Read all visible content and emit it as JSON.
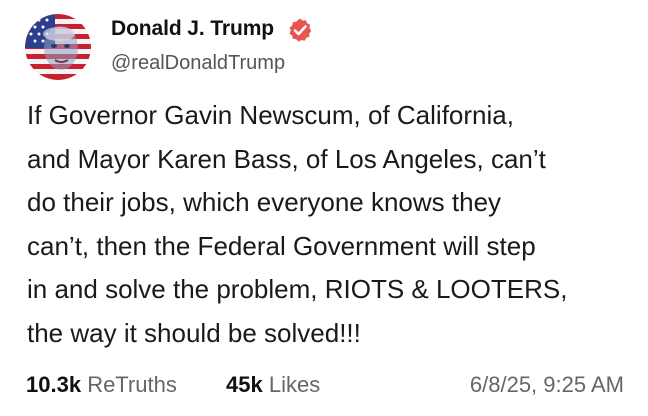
{
  "post": {
    "author": {
      "display_name": "Donald J. Trump",
      "handle": "@realDonaldTrump",
      "verified_icon": "verified-check-badge-icon",
      "avatar_icon": "american-flag-portrait-avatar"
    },
    "body_lines": [
      "If Governor Gavin Newscum, of California,",
      "and Mayor Karen Bass, of Los Angeles, can’t",
      "do their jobs, which everyone knows they",
      "can’t, then the Federal Government will step",
      "in and solve the problem, RIOTS & LOOTERS,",
      "the way it should be solved!!!"
    ],
    "stats": {
      "retruths_count": "10.3k",
      "retruths_label": "ReTruths",
      "likes_count": "45k",
      "likes_label": "Likes"
    },
    "timestamp": "6/8/25, 9:25 AM"
  },
  "colors": {
    "verified_badge": "#e6554f",
    "text": "#1a1a1a",
    "muted": "#666666"
  }
}
